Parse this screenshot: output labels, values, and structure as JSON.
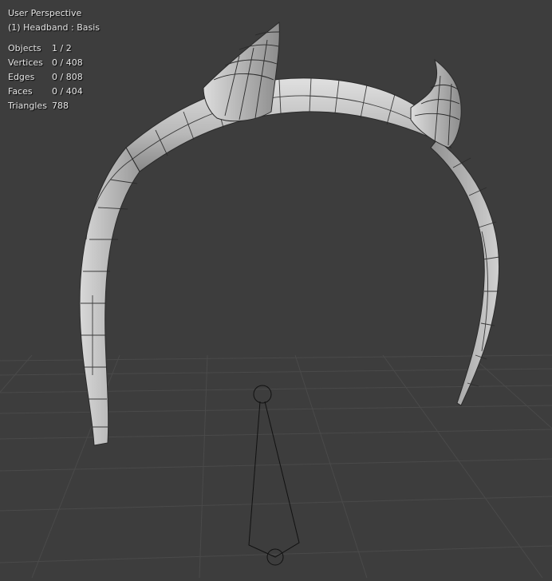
{
  "viewport": {
    "view_title": "User Perspective",
    "object_name": "(1) Headband : Basis",
    "stats": [
      {
        "label": "Objects",
        "value": "1 / 2"
      },
      {
        "label": "Vertices",
        "value": "0 / 408"
      },
      {
        "label": "Edges",
        "value": "0 / 808"
      },
      {
        "label": "Faces",
        "value": "0 / 404"
      },
      {
        "label": "Triangles",
        "value": "788"
      }
    ]
  },
  "colors": {
    "background": "#3d3d3d",
    "grid": "#4a4a4a",
    "mesh_light": "#c9c9c9",
    "mesh_shadow": "#7a7a7a",
    "wire": "#222222"
  }
}
